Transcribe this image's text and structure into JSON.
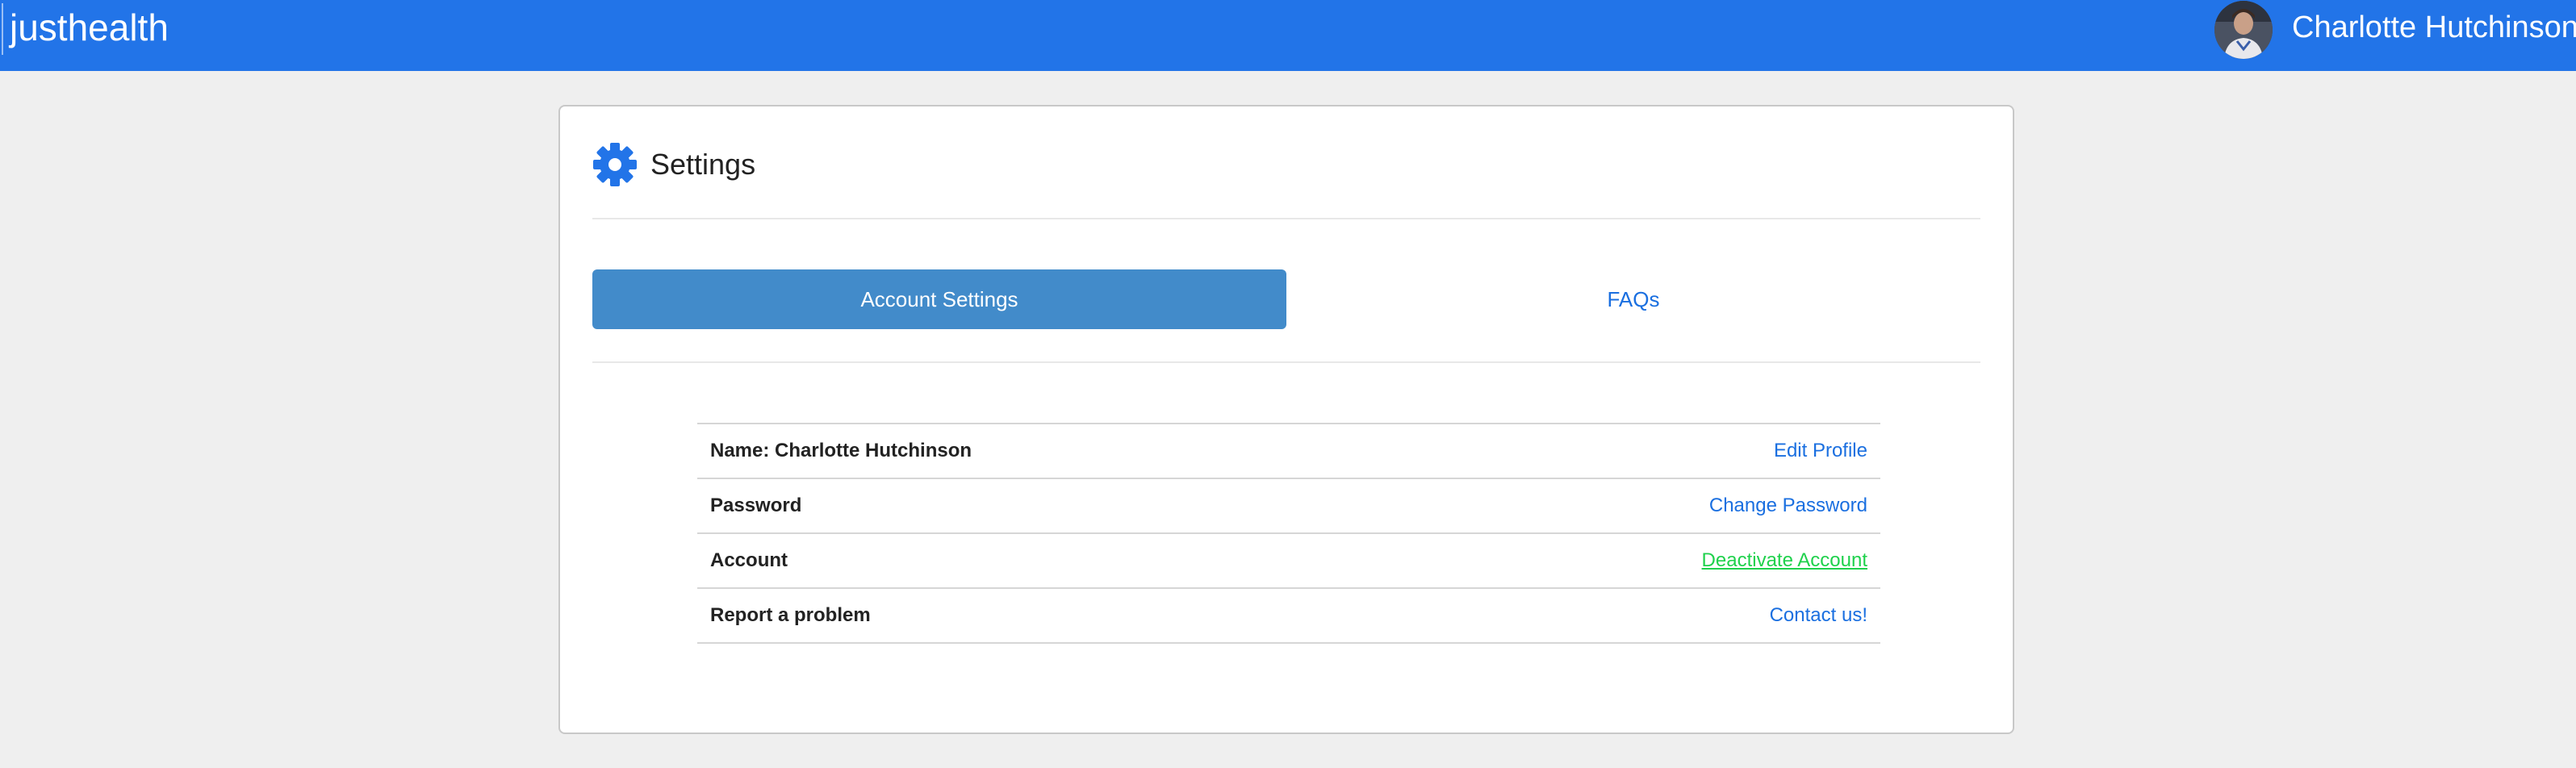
{
  "app": {
    "brand": "justhealth"
  },
  "user": {
    "name": "Charlotte Hutchinson"
  },
  "panel": {
    "icon": "gear-icon",
    "title": "Settings"
  },
  "tabs": [
    {
      "label": "Account Settings",
      "active": true
    },
    {
      "label": "FAQs",
      "active": false
    }
  ],
  "settings": [
    {
      "label": "Name: Charlotte Hutchinson",
      "action": "Edit Profile"
    },
    {
      "label": "Password",
      "action": "Change Password"
    },
    {
      "label": "Account",
      "action": "Deactivate Account"
    },
    {
      "label": "Report a problem",
      "action": "Contact us!"
    }
  ],
  "colors": {
    "topbar": "#2274e8",
    "accent": "#2274e8",
    "active_tab": "#428bca",
    "link": "#1a6fe0",
    "deactivate_link": "#1fd14c",
    "background": "#efefef"
  }
}
